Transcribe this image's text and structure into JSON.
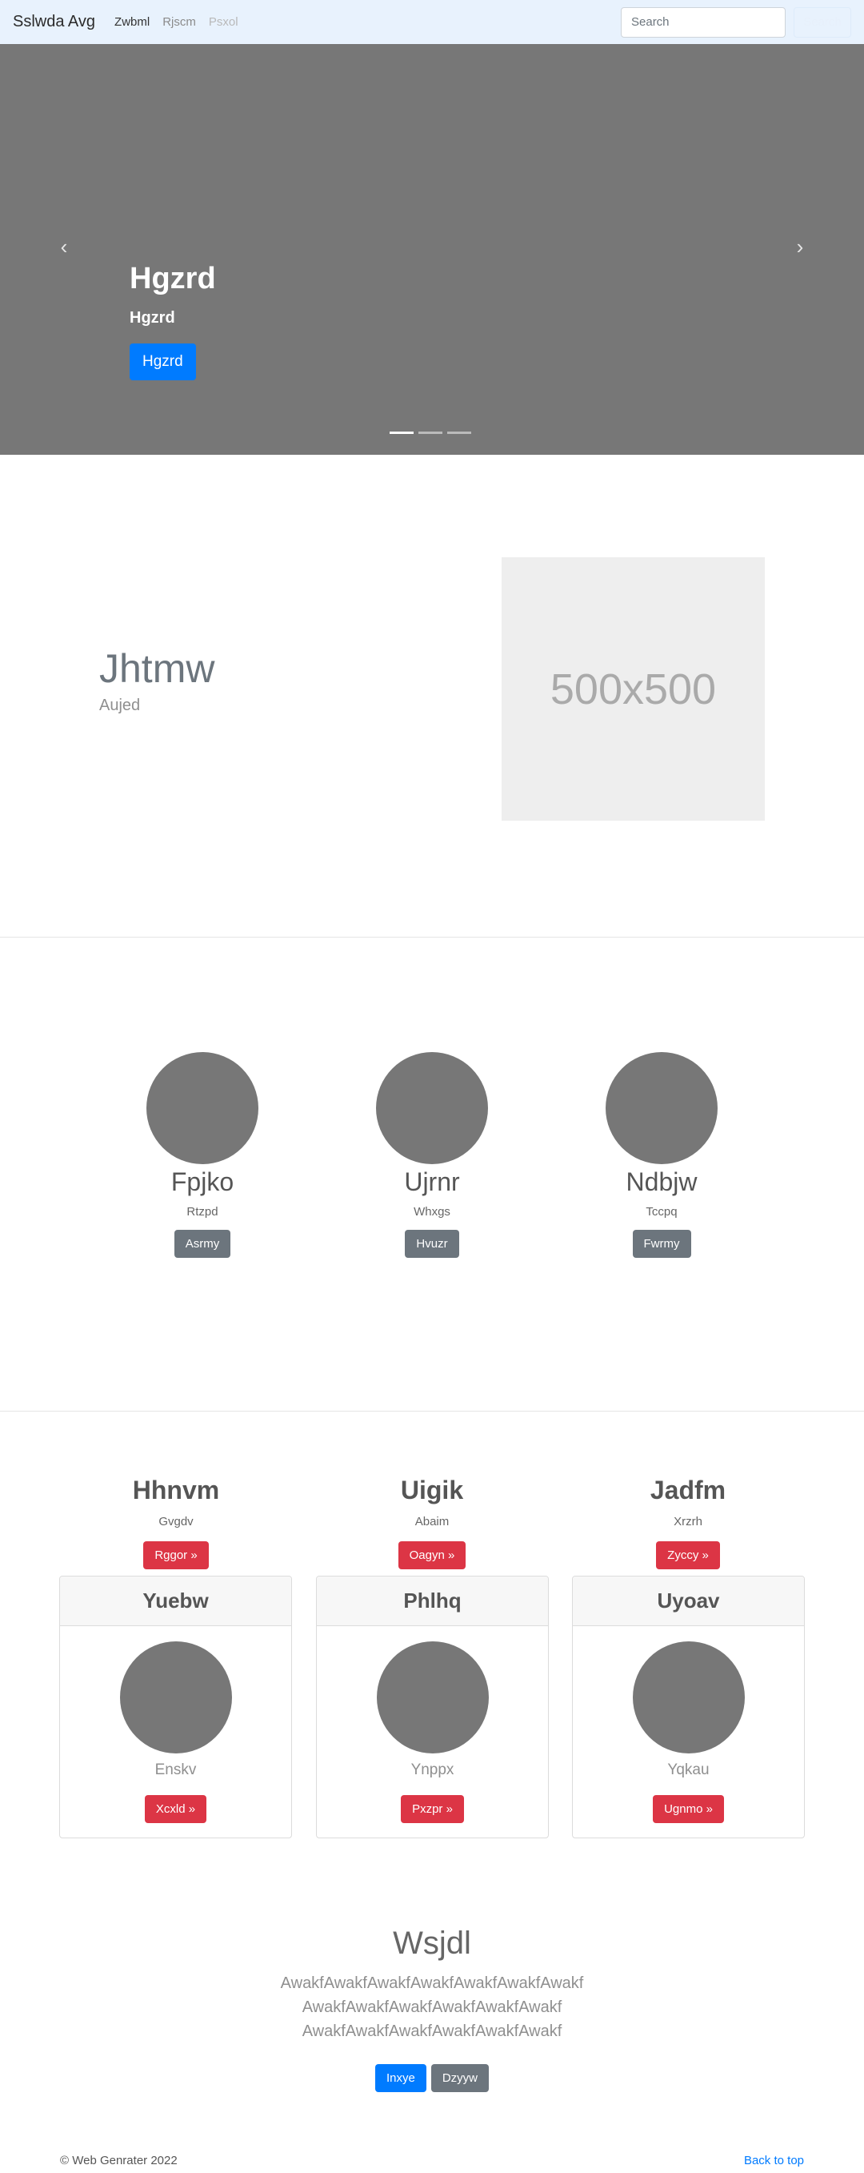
{
  "navbar": {
    "brand": "Sslwda Avg",
    "links": [
      "Zwbml",
      "Rjscm",
      "Psxol"
    ],
    "search_placeholder": "Search",
    "search_button": "Search"
  },
  "carousel": {
    "title": "Hgzrd",
    "subtitle": "Hgzrd",
    "button": "Hgzrd",
    "prev_icon": "‹",
    "next_icon": "›"
  },
  "featurette": {
    "heading": "Jhtmw",
    "lead": "Aujed",
    "image_label": "500x500"
  },
  "circles": [
    {
      "title": "Fpjko",
      "sub": "Rtzpd",
      "button": "Asrmy"
    },
    {
      "title": "Ujrnr",
      "sub": "Whxgs",
      "button": "Hvuzr"
    },
    {
      "title": "Ndbjw",
      "sub": "Tccpq",
      "button": "Fwrmy"
    }
  ],
  "headings": [
    {
      "title": "Hhnvm",
      "sub": "Gvgdv",
      "button": "Rggor »"
    },
    {
      "title": "Uigik",
      "sub": "Abaim",
      "button": "Oagyn »"
    },
    {
      "title": "Jadfm",
      "sub": "Xrzrh",
      "button": "Zyccy »"
    }
  ],
  "cards": [
    {
      "header": "Yuebw",
      "sub": "Enskv",
      "button": "Xcxld »"
    },
    {
      "header": "Phlhq",
      "sub": "Ynppx",
      "button": "Pxzpr »"
    },
    {
      "header": "Uyoav",
      "sub": "Yqkau",
      "button": "Ugnmo »"
    }
  ],
  "jumbotron": {
    "title": "Wsjdl",
    "lead": "AwakfAwakfAwakfAwakfAwakfAwakfAwakf AwakfAwakfAwakfAwakfAwakfAwakf AwakfAwakfAwakfAwakfAwakfAwakf",
    "primary_button": "Inxye",
    "secondary_button": "Dzyyw"
  },
  "footer": {
    "copyright": "© Web Genrater 2022",
    "back_to_top": "Back to top"
  },
  "colors": {
    "primary": "#007bff",
    "secondary": "#6c757d",
    "danger": "#dc3545",
    "navbar_bg": "#e8f2fd",
    "placeholder_gray": "#777777"
  }
}
